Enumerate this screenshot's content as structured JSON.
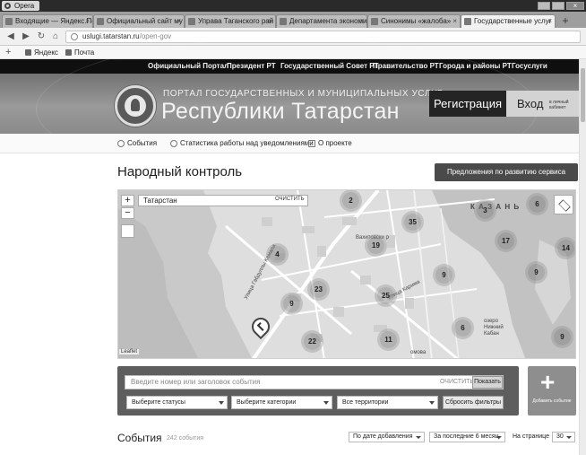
{
  "window": {
    "app_name": "Opera"
  },
  "tabs": [
    {
      "label": "Входящие — Яндекс.По",
      "active": false
    },
    {
      "label": "Официальный сайт му",
      "active": false
    },
    {
      "label": "Управа Таганского рай",
      "active": false
    },
    {
      "label": "Департамента экономи",
      "active": false
    },
    {
      "label": "Синонимы «жалоба»",
      "active": false
    },
    {
      "label": "Государственные услуг",
      "active": true
    }
  ],
  "address": {
    "host": "uslugi.tatarstan.ru",
    "path": "/open-gov"
  },
  "bookmarks": [
    {
      "label": "Яндекс"
    },
    {
      "label": "Почта"
    }
  ],
  "topnav": [
    {
      "label": "Официальный Портал"
    },
    {
      "label": "Президент РТ"
    },
    {
      "label": "Государственный Совет РТ"
    },
    {
      "label": "Правительство РТ"
    },
    {
      "label": "Города и районы РТ"
    },
    {
      "label": "Госуслуги"
    }
  ],
  "banner": {
    "subtitle": "ПОРТАЛ ГОСУДАРСТВЕННЫХ И МУНИЦИПАЛЬНЫХ УСЛУГ",
    "title": "Республики Татарстан",
    "register": "Регистрация",
    "login": "Вход",
    "login_sub": "в личный кабинет"
  },
  "subnav": [
    {
      "label": "События"
    },
    {
      "label": "Статистика работы над уведомлениями"
    },
    {
      "label": "О проекте"
    }
  ],
  "page": {
    "title": "Народный контроль",
    "suggest_button": "Предложения по развитию сервиса"
  },
  "map": {
    "search_value": "Татарстан",
    "clear": "ОЧИСТИТЬ",
    "zoom_in": "+",
    "zoom_out": "−",
    "attribution": "Leaflet",
    "city_label": "К А З А Н Ь",
    "district_label": "Вахитовски р",
    "street1": "Улица Габдуллы Камала",
    "street2": "Улица Карима",
    "lake1": "озеро Нижний Кабан",
    "bottom_street": "омова",
    "clusters": [
      "2",
      "3",
      "6",
      "35",
      "17",
      "14",
      "19",
      "4",
      "9",
      "23",
      "25",
      "9",
      "9",
      "6",
      "11",
      "22",
      "9"
    ]
  },
  "filters": {
    "search_placeholder": "Введите номер или заголовок события",
    "clear": "ОЧИСТИТЬ",
    "show": "Показать",
    "status": "Выберите статусы",
    "category": "Выберите категории",
    "territory": "Все территории",
    "reset": "Сбросить фильтры",
    "add_label": "Добавить событие"
  },
  "events": {
    "title": "События",
    "count": "242 события",
    "sort": "По дате добавления",
    "period": "За последние 6 месяц",
    "per_page_label": "На странице",
    "per_page": "30"
  }
}
